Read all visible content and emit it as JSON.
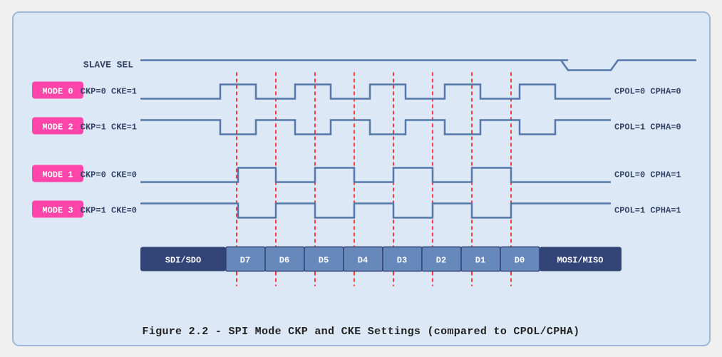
{
  "title": "Figure 2.2 - SPI Mode CKP and CKE Settings (compared to CPOL/CPHA)",
  "caption": "Figure 2.2 - SPI Mode CKP and CKE Settings (compared to CPOL/CPHA)",
  "diagram": {
    "slave_sel_label": "SLAVE SEL",
    "modes": [
      {
        "label": "MODE 0",
        "ckp": "CKP=0",
        "cke": "CKE=1",
        "cpol": "CPOL=0",
        "cpha": "CPHA=0"
      },
      {
        "label": "MODE 2",
        "ckp": "CKP=1",
        "cke": "CKE=1",
        "cpol": "CPOL=1",
        "cpha": "CPHA=0"
      },
      {
        "label": "MODE 1",
        "ckp": "CKP=0",
        "cke": "CKE=0",
        "cpol": "CPOL=0",
        "cpha": "CPHA=1"
      },
      {
        "label": "MODE 3",
        "ckp": "CKP=1",
        "cke": "CKE=0",
        "cpol": "CPOL=1",
        "cpha": "CPHA=1"
      }
    ],
    "data_labels": [
      "SDI/SDO",
      "D7",
      "D6",
      "D5",
      "D4",
      "D3",
      "D2",
      "D1",
      "D0",
      "MOSI/MISO"
    ]
  }
}
